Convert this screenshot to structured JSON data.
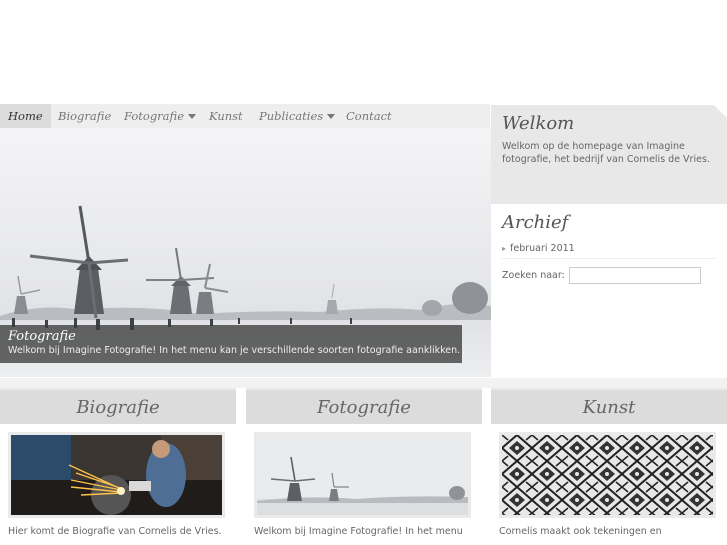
{
  "nav": {
    "items": [
      {
        "label": "Home"
      },
      {
        "label": "Biografie"
      },
      {
        "label": "Fotografie"
      },
      {
        "label": "Kunst"
      },
      {
        "label": "Publicaties"
      },
      {
        "label": "Contact"
      }
    ]
  },
  "hero": {
    "title": "Fotografie",
    "text": "Welkom bij Imagine Fotografie! In het menu kan je verschillende soorten fotografie aanklikken."
  },
  "sidebar": {
    "welkom_title": "Welkom",
    "welkom_text": "Welkom op de homepage van Imagine fotografie, het bedrijf van Cornelis de Vries.",
    "archief_title": "Archief",
    "archief_items": [
      {
        "label": "februari 2011"
      }
    ],
    "search_label": "Zoeken naar:",
    "search_value": ""
  },
  "columns": [
    {
      "title": "Biografie",
      "text": "Hier komt de Biografie van Cornelis de Vries."
    },
    {
      "title": "Fotografie",
      "text": "Welkom bij Imagine Fotografie! In het menu"
    },
    {
      "title": "Kunst",
      "text": "Cornelis maakt ook tekeningen en"
    }
  ],
  "colors": {
    "nav_bg": "#eeeeee",
    "sidebar_bg": "#e8e8e8",
    "column_header_bg": "#dcdcdc"
  }
}
